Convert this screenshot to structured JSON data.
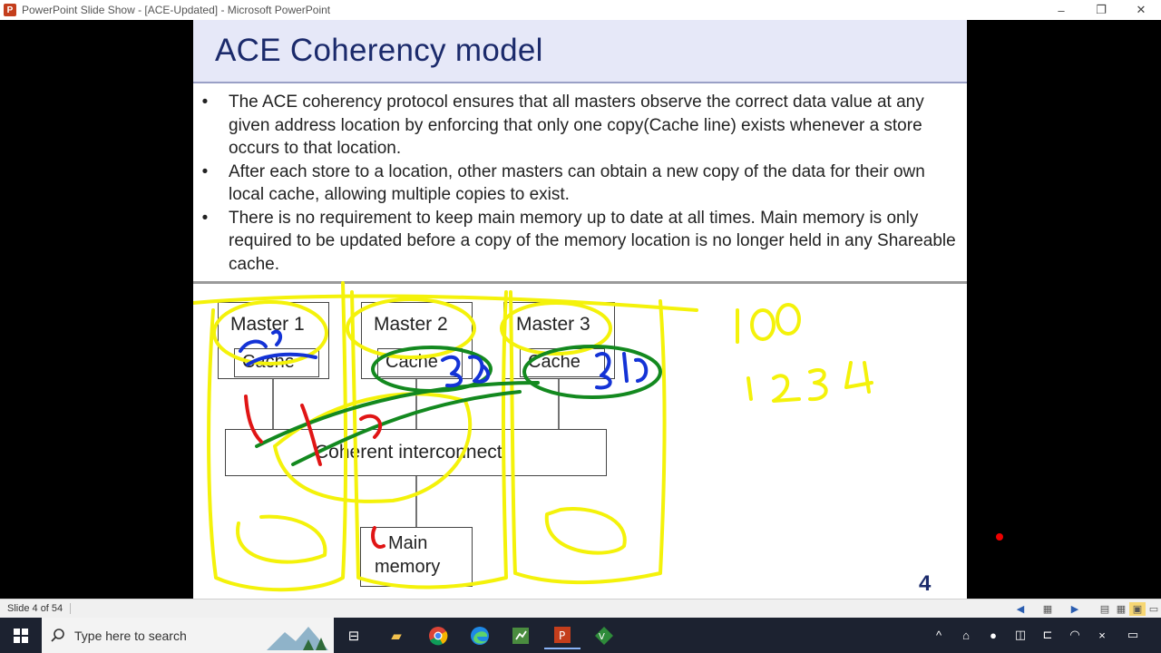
{
  "window": {
    "app_icon_letter": "P",
    "title": "PowerPoint Slide Show - [ACE-Updated] - Microsoft PowerPoint",
    "minimize_glyph": "–",
    "restore_glyph": "❐",
    "close_glyph": "✕"
  },
  "slide": {
    "title": "ACE Coherency model",
    "bullet_glyph": "•",
    "bullets": [
      "The ACE coherency protocol ensures that all masters observe the correct data value at any given address location by enforcing that only one copy(Cache line) exists whenever a store occurs to that location.",
      "After each store to a location, other masters can obtain a new copy of the data for their own local cache, allowing multiple copies to exist.",
      "There is no requirement to keep main memory up to date at all times. Main memory is only required to be updated before a copy of the memory location is no longer held in any Shareable cache."
    ],
    "diagram": {
      "masters": [
        {
          "label": "Master 1",
          "cache": "Cache"
        },
        {
          "label": "Master 2",
          "cache": "Cache"
        },
        {
          "label": "Master 3",
          "cache": "Cache"
        }
      ],
      "interconnect": "Coherent interconnect",
      "memory_line1": "Main",
      "memory_line2": "memory"
    },
    "number": "4",
    "ink_colors": {
      "yellow": "#f4f20a",
      "blue": "#1433d6",
      "green": "#13891f",
      "red": "#e01515"
    }
  },
  "status": {
    "slide_counter": "Slide 4 of 54"
  },
  "taskbar": {
    "search_placeholder": "Type here to search"
  }
}
